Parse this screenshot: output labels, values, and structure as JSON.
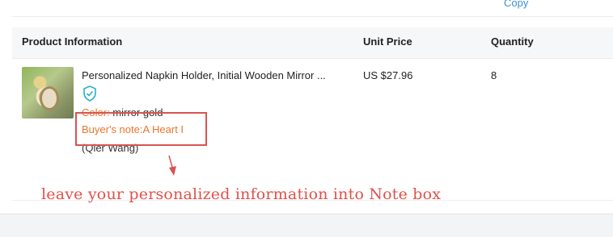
{
  "top_link": "Copy",
  "table": {
    "headers": {
      "product": "Product Information",
      "unit_price": "Unit Price",
      "quantity": "Quantity"
    },
    "row": {
      "title": "Personalized Napkin Holder, Initial Wooden Mirror ...",
      "color_label": "Color:",
      "color_value": " mirror gold",
      "buyer_note": "Buyer's note:A Heart I",
      "name_line": "(Qier Wang)",
      "unit_price": "US $27.96",
      "quantity": "8",
      "badge_icon": "shield-check-icon"
    }
  },
  "annotation": {
    "text": "leave your personalized information into Note box",
    "color": "#e0514a"
  },
  "colors": {
    "accent_orange": "#e8762c",
    "link_blue": "#3a8fd6",
    "badge_teal": "#2bb0c9"
  }
}
